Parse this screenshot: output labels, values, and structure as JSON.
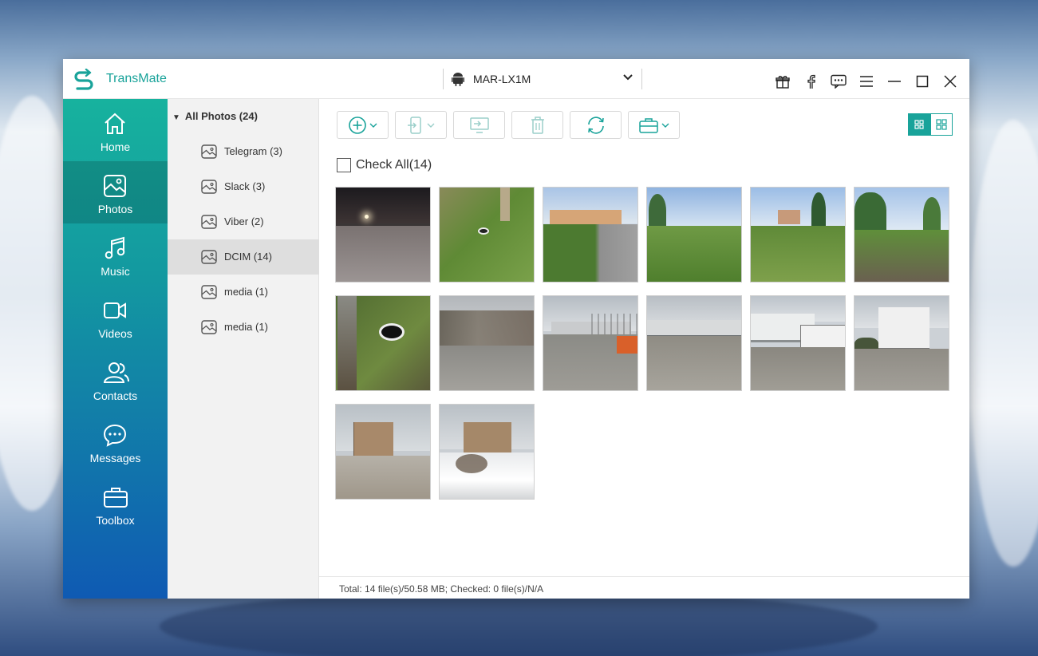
{
  "app": {
    "title": "TransMate",
    "brand_color": "#19a39a"
  },
  "device": {
    "name": "MAR-LX1M",
    "icon": "android-icon"
  },
  "titlebar_icons": [
    "gift-icon",
    "facebook-icon",
    "feedback-icon",
    "menu-icon",
    "minimize-icon",
    "maximize-icon",
    "close-icon"
  ],
  "sidebar": {
    "items": [
      {
        "label": "Home",
        "icon": "home-icon"
      },
      {
        "label": "Photos",
        "icon": "photo-icon",
        "active": true
      },
      {
        "label": "Music",
        "icon": "music-icon"
      },
      {
        "label": "Videos",
        "icon": "video-icon"
      },
      {
        "label": "Contacts",
        "icon": "contacts-icon"
      },
      {
        "label": "Messages",
        "icon": "messages-icon"
      },
      {
        "label": "Toolbox",
        "icon": "toolbox-icon"
      }
    ]
  },
  "albums": {
    "header": "All Photos (24)",
    "items": [
      {
        "label": "Telegram (3)"
      },
      {
        "label": "Slack (3)"
      },
      {
        "label": "Viber (2)"
      },
      {
        "label": "DCIM (14)",
        "active": true
      },
      {
        "label": "media (1)"
      },
      {
        "label": "media (1)"
      }
    ]
  },
  "toolbar": {
    "buttons": [
      "add-icon",
      "export-to-device-icon",
      "export-to-pc-icon",
      "delete-icon",
      "refresh-icon",
      "toolbox-icon"
    ]
  },
  "view_modes": [
    "large-grid",
    "small-grid"
  ],
  "check_all": {
    "label": "Check All(14)",
    "checked": false
  },
  "photos": {
    "count": 14
  },
  "status": {
    "text": "Total: 14 file(s)/50.58 MB; Checked: 0 file(s)/N/A"
  }
}
